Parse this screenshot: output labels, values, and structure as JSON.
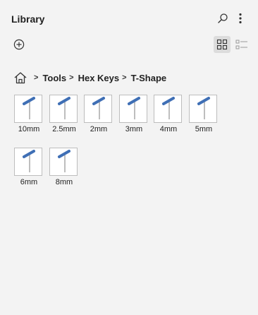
{
  "header": {
    "title": "Library",
    "search_icon": "search-icon",
    "more_icon": "more-vertical-icon"
  },
  "toolbar": {
    "add_icon": "add-circle-icon",
    "grid_view_icon": "grid-view-icon",
    "list_view_icon": "list-view-icon",
    "active_view": "grid"
  },
  "breadcrumb": {
    "home_icon": "home-icon",
    "separator": ">",
    "items": [
      "Tools",
      "Hex Keys",
      "T-Shape"
    ]
  },
  "library": {
    "items": [
      {
        "label": "10mm"
      },
      {
        "label": "2.5mm"
      },
      {
        "label": "2mm"
      },
      {
        "label": "3mm"
      },
      {
        "label": "4mm"
      },
      {
        "label": "5mm"
      },
      {
        "label": "6mm"
      },
      {
        "label": "8mm"
      }
    ]
  },
  "colors": {
    "background": "#f3f3f3",
    "handle": "#3f6fb5",
    "shaft": "#9a9a9a",
    "active_view_bg": "#dcdcdc"
  }
}
